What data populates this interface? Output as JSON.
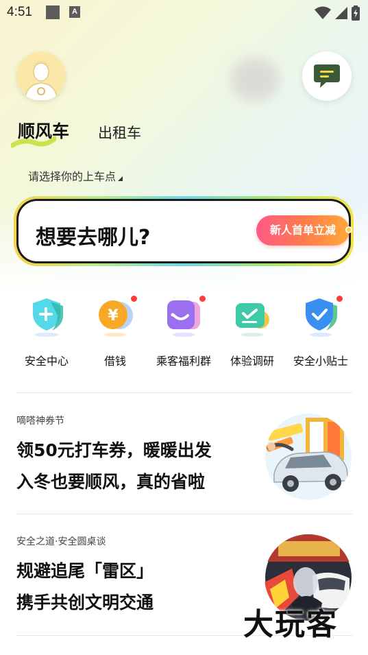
{
  "status_bar": {
    "time": "4:51",
    "notification_letter": "A"
  },
  "header": {
    "avatar_icon": "avatar-icon",
    "message_icon": "message-icon"
  },
  "tabs": [
    {
      "label": "顺风车",
      "active": true
    },
    {
      "label": "出租车",
      "active": false
    }
  ],
  "pickup": {
    "label": "请选择你的上车点"
  },
  "search": {
    "placeholder": "想要去哪儿?",
    "promo": "新人首单立减"
  },
  "services": [
    {
      "label": "安全中心",
      "icon": "safety-center-icon",
      "badge": false,
      "color": "#31c1e0"
    },
    {
      "label": "借钱",
      "icon": "loan-icon",
      "badge": true,
      "color": "#f5a623"
    },
    {
      "label": "乘客福利群",
      "icon": "benefit-group-icon",
      "badge": true,
      "color": "#9b6cf0"
    },
    {
      "label": "体验调研",
      "icon": "survey-icon",
      "badge": false,
      "color": "#3ec9a7"
    },
    {
      "label": "安全小贴士",
      "icon": "safety-tips-icon",
      "badge": true,
      "color": "#3b8ff0"
    }
  ],
  "articles": [
    {
      "tag": "嘀嗒神券节",
      "title_line1": "领50元打车券，暖暖出发",
      "title_line2": "入冬也要顺风，真的省啦",
      "image": "coupon-festival-image"
    },
    {
      "tag": "安全之道·安全圆桌谈",
      "title_line1": "规避追尾「雷区」",
      "title_line2": "携手共创文明交通",
      "image": "traffic-safety-image"
    }
  ],
  "watermark": "大玩客",
  "colors": {
    "accent_yellow": "#f6d24a",
    "promo_pink": "#ff5a86",
    "badge_red": "#ff3b3b"
  }
}
